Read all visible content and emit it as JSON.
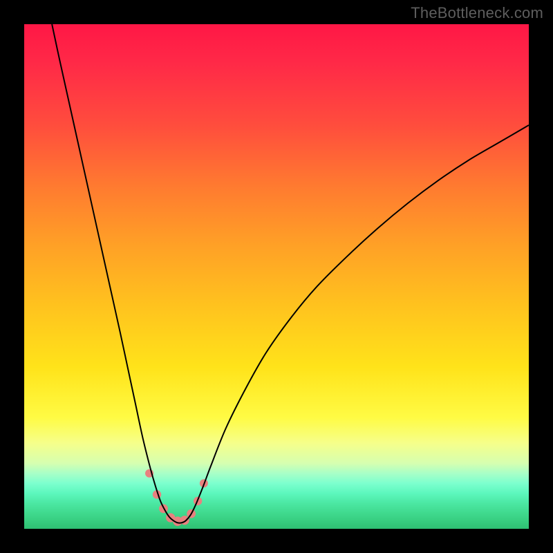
{
  "watermark": "TheBottleneck.com",
  "chart_data": {
    "type": "line",
    "title": "",
    "xlabel": "",
    "ylabel": "",
    "xlim": [
      0,
      100
    ],
    "ylim": [
      0,
      100
    ],
    "gradient_stops": [
      {
        "pct": 0,
        "color": "#ff1746"
      },
      {
        "pct": 8,
        "color": "#ff2a47"
      },
      {
        "pct": 20,
        "color": "#ff4d3d"
      },
      {
        "pct": 32,
        "color": "#ff7a30"
      },
      {
        "pct": 44,
        "color": "#ffa126"
      },
      {
        "pct": 56,
        "color": "#ffc31e"
      },
      {
        "pct": 68,
        "color": "#ffe31a"
      },
      {
        "pct": 78,
        "color": "#fffb44"
      },
      {
        "pct": 83,
        "color": "#f6ff8a"
      },
      {
        "pct": 87,
        "color": "#d6ffb0"
      },
      {
        "pct": 89,
        "color": "#a8ffc7"
      },
      {
        "pct": 91,
        "color": "#7cffce"
      },
      {
        "pct": 93,
        "color": "#5cf7bd"
      },
      {
        "pct": 95,
        "color": "#4be7a2"
      },
      {
        "pct": 97,
        "color": "#3fd98d"
      },
      {
        "pct": 99,
        "color": "#34c97b"
      },
      {
        "pct": 100,
        "color": "#2ebf72"
      }
    ],
    "series": [
      {
        "name": "curve",
        "color": "#000000",
        "stroke_width": 2,
        "points": [
          {
            "x": 5.5,
            "y": 100
          },
          {
            "x": 7,
            "y": 93
          },
          {
            "x": 9,
            "y": 84
          },
          {
            "x": 11,
            "y": 75
          },
          {
            "x": 13,
            "y": 66
          },
          {
            "x": 15,
            "y": 57
          },
          {
            "x": 17,
            "y": 48
          },
          {
            "x": 19,
            "y": 39
          },
          {
            "x": 20.5,
            "y": 32
          },
          {
            "x": 22,
            "y": 25
          },
          {
            "x": 23.5,
            "y": 18
          },
          {
            "x": 25,
            "y": 12
          },
          {
            "x": 26,
            "y": 8.5
          },
          {
            "x": 27,
            "y": 5.5
          },
          {
            "x": 28,
            "y": 3.5
          },
          {
            "x": 28.8,
            "y": 2.3
          },
          {
            "x": 29.6,
            "y": 1.6
          },
          {
            "x": 30.4,
            "y": 1.2
          },
          {
            "x": 31.2,
            "y": 1.2
          },
          {
            "x": 32,
            "y": 1.6
          },
          {
            "x": 33,
            "y": 2.8
          },
          {
            "x": 34,
            "y": 4.8
          },
          {
            "x": 35.5,
            "y": 8.5
          },
          {
            "x": 37,
            "y": 12.5
          },
          {
            "x": 40,
            "y": 20
          },
          {
            "x": 44,
            "y": 28
          },
          {
            "x": 48,
            "y": 35
          },
          {
            "x": 53,
            "y": 42
          },
          {
            "x": 58,
            "y": 48
          },
          {
            "x": 64,
            "y": 54
          },
          {
            "x": 70,
            "y": 59.5
          },
          {
            "x": 76,
            "y": 64.5
          },
          {
            "x": 82,
            "y": 69
          },
          {
            "x": 88,
            "y": 73
          },
          {
            "x": 94,
            "y": 76.5
          },
          {
            "x": 100,
            "y": 80
          }
        ]
      }
    ],
    "markers": [
      {
        "x": 24.8,
        "y": 11,
        "r": 6,
        "color": "#e8817f"
      },
      {
        "x": 26.3,
        "y": 6.8,
        "r": 6.2,
        "color": "#e8817f"
      },
      {
        "x": 27.6,
        "y": 4.0,
        "r": 6.4,
        "color": "#e8817f"
      },
      {
        "x": 29.0,
        "y": 2.2,
        "r": 6.6,
        "color": "#e8817f"
      },
      {
        "x": 30.4,
        "y": 1.5,
        "r": 6.8,
        "color": "#e8817f"
      },
      {
        "x": 31.8,
        "y": 1.7,
        "r": 6.6,
        "color": "#e8817f"
      },
      {
        "x": 33.1,
        "y": 3.0,
        "r": 6.4,
        "color": "#e8817f"
      },
      {
        "x": 34.4,
        "y": 5.5,
        "r": 6.2,
        "color": "#e8817f"
      },
      {
        "x": 35.6,
        "y": 9.0,
        "r": 6,
        "color": "#e8817f"
      }
    ]
  }
}
